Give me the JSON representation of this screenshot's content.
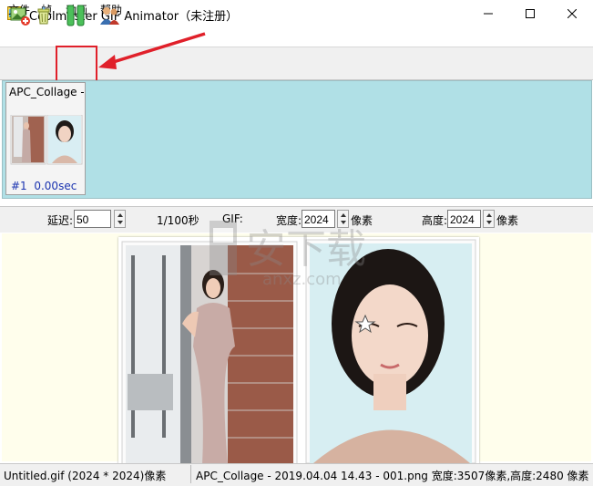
{
  "window": {
    "title": "Coolmuster GIF Animator（未注册）"
  },
  "menu": {
    "file": "文件",
    "frame": "帧",
    "animation": "动画",
    "help": "帮助"
  },
  "toolbar": {
    "icons": [
      "add-image-icon",
      "delete-icon",
      "pause-icon",
      "people-icon"
    ],
    "highlight_color": "#e0202a"
  },
  "frames": [
    {
      "name": "APC_Collage -",
      "index": "#1",
      "duration": "0.00sec"
    }
  ],
  "props": {
    "delay_label": "延迟:",
    "delay_value": "50",
    "unit_label": "1/100秒",
    "gif_label": "GIF:",
    "width_label": "宽度:",
    "width_value": "2024",
    "width_unit": "像素",
    "height_label": "高度:",
    "height_value": "2024",
    "height_unit": "像素"
  },
  "preview": {
    "watermark_text": "安下载",
    "watermark_url": "anxz.com"
  },
  "status": {
    "left": "Untitled.gif (2024 * 2024)像素",
    "right": "APC_Collage - 2019.04.04 14.43 - 001.png 宽度:3507像素,高度:2480 像素"
  },
  "colors": {
    "strip_bg": "#b0e0e6",
    "preview_bg": "#fffeec",
    "frame_info": "#1a33b0"
  }
}
